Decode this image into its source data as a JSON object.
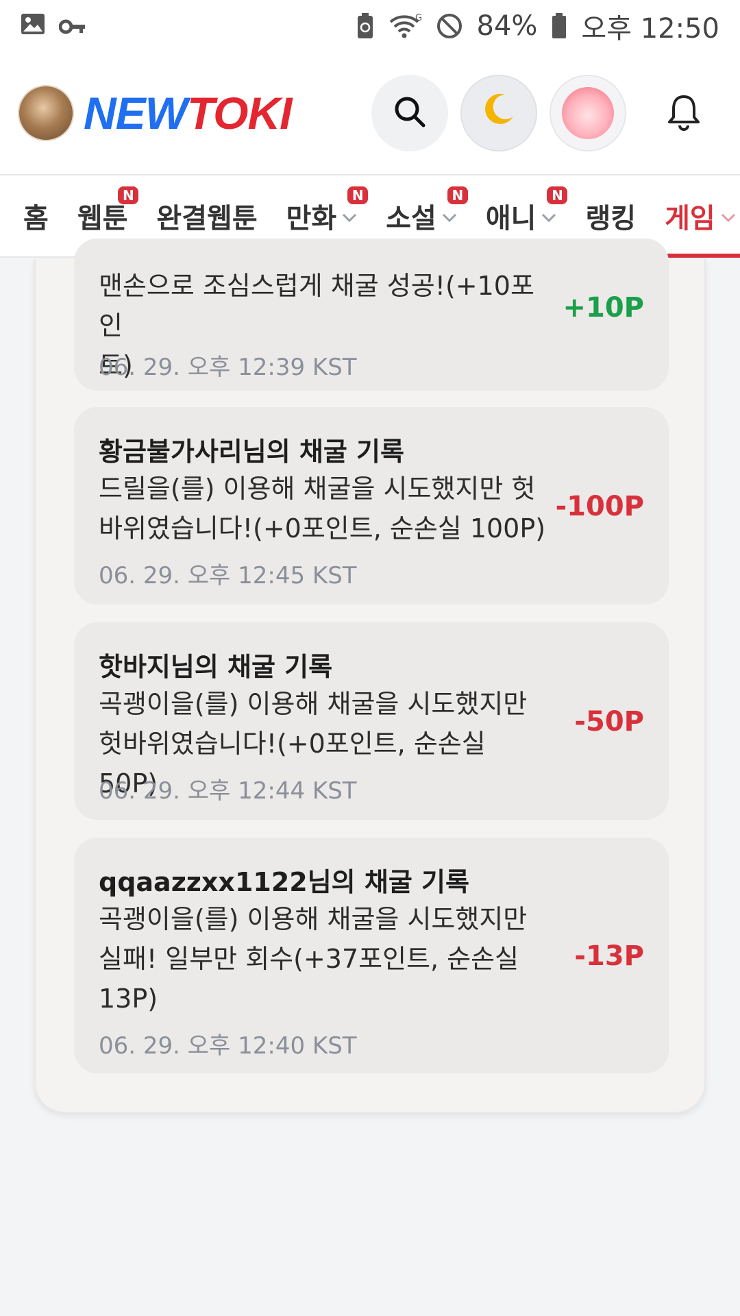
{
  "status_bar": {
    "battery": "84%",
    "time": "오후 12:50"
  },
  "header": {
    "brand_part1": "NEW",
    "brand_part2": "TOKI",
    "colors": {
      "brand_blue": "#1f6ff0",
      "brand_red": "#e3262f"
    }
  },
  "nav": {
    "items": [
      {
        "label": "홈",
        "badge": "",
        "has_dropdown": false
      },
      {
        "label": "웹툰",
        "badge": "N",
        "has_dropdown": false
      },
      {
        "label": "완결웹툰",
        "badge": "",
        "has_dropdown": false
      },
      {
        "label": "만화",
        "badge": "N",
        "has_dropdown": true
      },
      {
        "label": "소설",
        "badge": "N",
        "has_dropdown": true
      },
      {
        "label": "애니",
        "badge": "N",
        "has_dropdown": true
      },
      {
        "label": "랭킹",
        "badge": "",
        "has_dropdown": false
      },
      {
        "label": "게임",
        "badge": "",
        "has_dropdown": true,
        "active": true
      }
    ]
  },
  "records": [
    {
      "title": "",
      "message_lines": [
        "맨손으로 조심스럽게 채굴 성공!(+10포인",
        "트)"
      ],
      "time": "06. 29. 오후 12:39 KST",
      "points": "+10P",
      "positive": true
    },
    {
      "title": "황금불가사리님의 채굴 기록",
      "message_lines": [
        "드릴을(를) 이용해 채굴을 시도했지만 헛",
        "바위였습니다!(+0포인트, 순손실 100P)"
      ],
      "time": "06. 29. 오후 12:45 KST",
      "points": "-100P",
      "positive": false
    },
    {
      "title": "핫바지님의 채굴 기록",
      "message_lines": [
        "곡괭이을(를) 이용해 채굴을 시도했지만",
        "헛바위였습니다!(+0포인트, 순손실 50P)"
      ],
      "time": "06. 29. 오후 12:44 KST",
      "points": "-50P",
      "positive": false
    },
    {
      "title": "qqaazzxx1122님의 채굴 기록",
      "message_lines": [
        "곡괭이을(를) 이용해 채굴을 시도했지만",
        "실패! 일부만 회수(+37포인트, 순손실",
        "13P)"
      ],
      "time": "06. 29. 오후 12:40 KST",
      "points": "-13P",
      "positive": false
    }
  ]
}
